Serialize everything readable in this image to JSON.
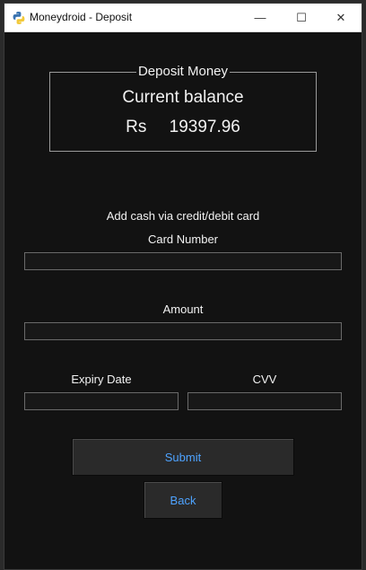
{
  "window": {
    "title": "Moneydroid - Deposit",
    "controls": {
      "minimize": "—",
      "maximize": "☐",
      "close": "✕"
    }
  },
  "balance_box": {
    "legend": "Deposit Money",
    "label": "Current balance",
    "currency": "Rs",
    "amount": "19397.96"
  },
  "form": {
    "heading": "Add cash via credit/debit card",
    "card_number_label": "Card Number",
    "card_number_value": "",
    "amount_label": "Amount",
    "amount_value": "",
    "expiry_label": "Expiry Date",
    "expiry_value": "",
    "cvv_label": "CVV",
    "cvv_value": ""
  },
  "buttons": {
    "submit": "Submit",
    "back": "Back"
  },
  "colors": {
    "background": "#121212",
    "button_text": "#4ea3ff",
    "text": "#f2f2f2"
  }
}
